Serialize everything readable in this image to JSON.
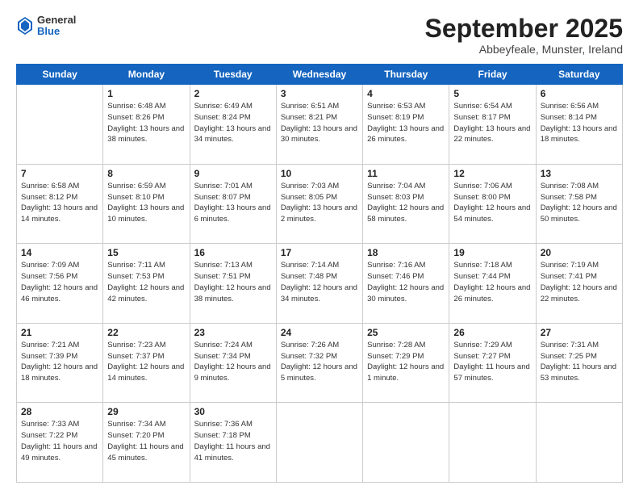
{
  "logo": {
    "general": "General",
    "blue": "Blue"
  },
  "header": {
    "month": "September 2025",
    "location": "Abbeyfeale, Munster, Ireland"
  },
  "weekdays": [
    "Sunday",
    "Monday",
    "Tuesday",
    "Wednesday",
    "Thursday",
    "Friday",
    "Saturday"
  ],
  "weeks": [
    [
      {
        "day": "",
        "info": ""
      },
      {
        "day": "1",
        "info": "Sunrise: 6:48 AM\nSunset: 8:26 PM\nDaylight: 13 hours\nand 38 minutes."
      },
      {
        "day": "2",
        "info": "Sunrise: 6:49 AM\nSunset: 8:24 PM\nDaylight: 13 hours\nand 34 minutes."
      },
      {
        "day": "3",
        "info": "Sunrise: 6:51 AM\nSunset: 8:21 PM\nDaylight: 13 hours\nand 30 minutes."
      },
      {
        "day": "4",
        "info": "Sunrise: 6:53 AM\nSunset: 8:19 PM\nDaylight: 13 hours\nand 26 minutes."
      },
      {
        "day": "5",
        "info": "Sunrise: 6:54 AM\nSunset: 8:17 PM\nDaylight: 13 hours\nand 22 minutes."
      },
      {
        "day": "6",
        "info": "Sunrise: 6:56 AM\nSunset: 8:14 PM\nDaylight: 13 hours\nand 18 minutes."
      }
    ],
    [
      {
        "day": "7",
        "info": "Sunrise: 6:58 AM\nSunset: 8:12 PM\nDaylight: 13 hours\nand 14 minutes."
      },
      {
        "day": "8",
        "info": "Sunrise: 6:59 AM\nSunset: 8:10 PM\nDaylight: 13 hours\nand 10 minutes."
      },
      {
        "day": "9",
        "info": "Sunrise: 7:01 AM\nSunset: 8:07 PM\nDaylight: 13 hours\nand 6 minutes."
      },
      {
        "day": "10",
        "info": "Sunrise: 7:03 AM\nSunset: 8:05 PM\nDaylight: 13 hours\nand 2 minutes."
      },
      {
        "day": "11",
        "info": "Sunrise: 7:04 AM\nSunset: 8:03 PM\nDaylight: 12 hours\nand 58 minutes."
      },
      {
        "day": "12",
        "info": "Sunrise: 7:06 AM\nSunset: 8:00 PM\nDaylight: 12 hours\nand 54 minutes."
      },
      {
        "day": "13",
        "info": "Sunrise: 7:08 AM\nSunset: 7:58 PM\nDaylight: 12 hours\nand 50 minutes."
      }
    ],
    [
      {
        "day": "14",
        "info": "Sunrise: 7:09 AM\nSunset: 7:56 PM\nDaylight: 12 hours\nand 46 minutes."
      },
      {
        "day": "15",
        "info": "Sunrise: 7:11 AM\nSunset: 7:53 PM\nDaylight: 12 hours\nand 42 minutes."
      },
      {
        "day": "16",
        "info": "Sunrise: 7:13 AM\nSunset: 7:51 PM\nDaylight: 12 hours\nand 38 minutes."
      },
      {
        "day": "17",
        "info": "Sunrise: 7:14 AM\nSunset: 7:48 PM\nDaylight: 12 hours\nand 34 minutes."
      },
      {
        "day": "18",
        "info": "Sunrise: 7:16 AM\nSunset: 7:46 PM\nDaylight: 12 hours\nand 30 minutes."
      },
      {
        "day": "19",
        "info": "Sunrise: 7:18 AM\nSunset: 7:44 PM\nDaylight: 12 hours\nand 26 minutes."
      },
      {
        "day": "20",
        "info": "Sunrise: 7:19 AM\nSunset: 7:41 PM\nDaylight: 12 hours\nand 22 minutes."
      }
    ],
    [
      {
        "day": "21",
        "info": "Sunrise: 7:21 AM\nSunset: 7:39 PM\nDaylight: 12 hours\nand 18 minutes."
      },
      {
        "day": "22",
        "info": "Sunrise: 7:23 AM\nSunset: 7:37 PM\nDaylight: 12 hours\nand 14 minutes."
      },
      {
        "day": "23",
        "info": "Sunrise: 7:24 AM\nSunset: 7:34 PM\nDaylight: 12 hours\nand 9 minutes."
      },
      {
        "day": "24",
        "info": "Sunrise: 7:26 AM\nSunset: 7:32 PM\nDaylight: 12 hours\nand 5 minutes."
      },
      {
        "day": "25",
        "info": "Sunrise: 7:28 AM\nSunset: 7:29 PM\nDaylight: 12 hours\nand 1 minute."
      },
      {
        "day": "26",
        "info": "Sunrise: 7:29 AM\nSunset: 7:27 PM\nDaylight: 11 hours\nand 57 minutes."
      },
      {
        "day": "27",
        "info": "Sunrise: 7:31 AM\nSunset: 7:25 PM\nDaylight: 11 hours\nand 53 minutes."
      }
    ],
    [
      {
        "day": "28",
        "info": "Sunrise: 7:33 AM\nSunset: 7:22 PM\nDaylight: 11 hours\nand 49 minutes."
      },
      {
        "day": "29",
        "info": "Sunrise: 7:34 AM\nSunset: 7:20 PM\nDaylight: 11 hours\nand 45 minutes."
      },
      {
        "day": "30",
        "info": "Sunrise: 7:36 AM\nSunset: 7:18 PM\nDaylight: 11 hours\nand 41 minutes."
      },
      {
        "day": "",
        "info": ""
      },
      {
        "day": "",
        "info": ""
      },
      {
        "day": "",
        "info": ""
      },
      {
        "day": "",
        "info": ""
      }
    ]
  ]
}
